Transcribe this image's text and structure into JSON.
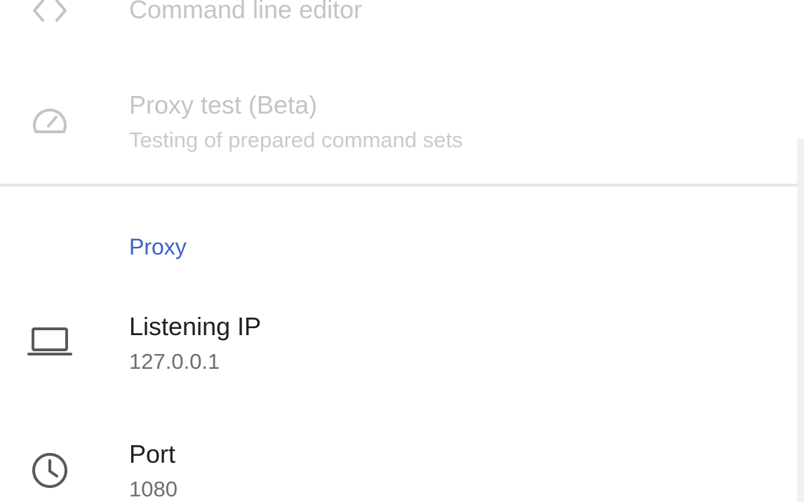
{
  "advanced_items": [
    {
      "title": "Command line editor",
      "icon": "code-icon"
    },
    {
      "title": "Proxy test (Beta)",
      "subtitle": "Testing of prepared command sets",
      "icon": "speedometer-icon"
    }
  ],
  "proxy_section": {
    "header": "Proxy",
    "items": [
      {
        "title": "Listening IP",
        "value": "127.0.0.1",
        "icon": "laptop-icon"
      },
      {
        "title": "Port",
        "value": "1080",
        "icon": "clock-icon"
      }
    ]
  },
  "colors": {
    "accent": "#3f5fc8",
    "disabled_text": "#c4c4c4",
    "primary_text": "#1f1f1f",
    "secondary_text": "#6e6e6e"
  }
}
